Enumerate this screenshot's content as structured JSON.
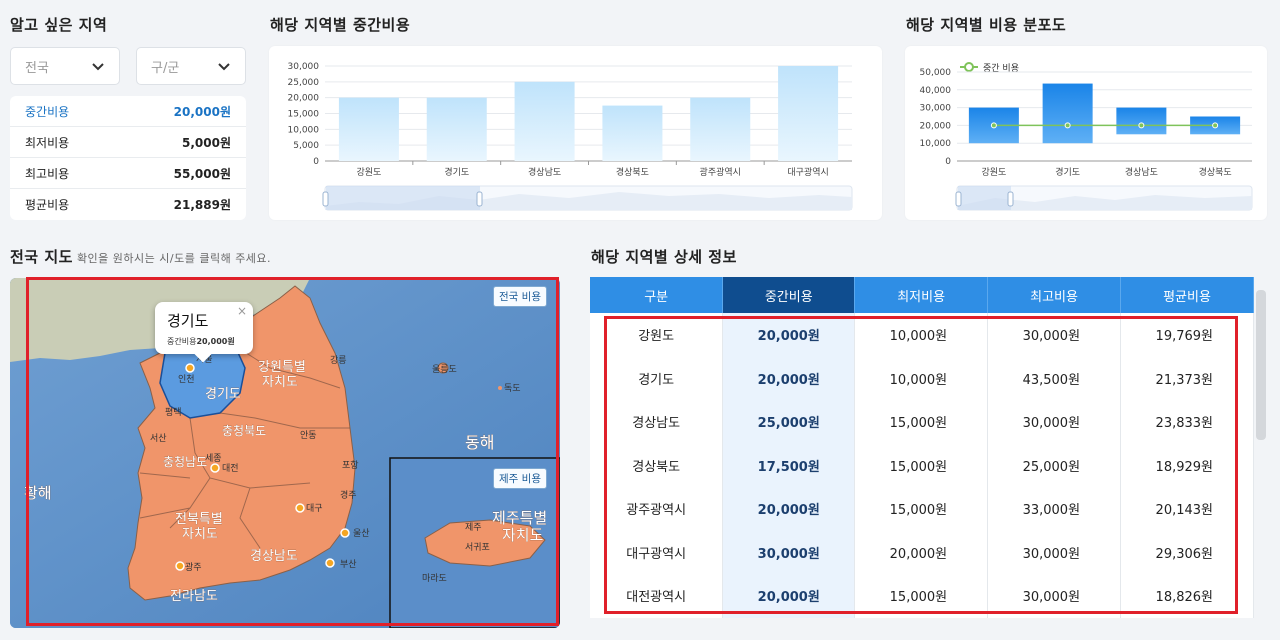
{
  "filters": {
    "title": "알고 싶은 지역",
    "region_select": "전국",
    "district_select": "구/군"
  },
  "stats": [
    {
      "label": "중간비용",
      "value": "20,000원",
      "active": true
    },
    {
      "label": "최저비용",
      "value": "5,000원"
    },
    {
      "label": "최고비용",
      "value": "55,000원"
    },
    {
      "label": "평균비용",
      "value": "21,889원"
    }
  ],
  "median_chart": {
    "title": "해당 지역별 중간비용",
    "chart_data": {
      "type": "bar",
      "categories": [
        "강원도",
        "경기도",
        "경상남도",
        "경상북도",
        "광주광역시",
        "대구광역시"
      ],
      "values": [
        20000,
        20000,
        25000,
        17500,
        20000,
        30000
      ],
      "yticks": [
        "30,000",
        "25,000",
        "20,000",
        "15,000",
        "10,000",
        "5,000",
        "0"
      ],
      "ylim": [
        0,
        30000
      ]
    }
  },
  "dist_chart": {
    "title": "해당 지역별 비용 분포도",
    "legend": "중간 비용",
    "chart_data": {
      "type": "bar",
      "categories": [
        "강원도",
        "경기도",
        "경상남도",
        "경상북도"
      ],
      "range_low": [
        10000,
        10000,
        15000,
        15000
      ],
      "range_high": [
        30000,
        43500,
        30000,
        25000
      ],
      "median": [
        20000,
        20000,
        20000,
        20000
      ],
      "yticks": [
        "50,000",
        "40,000",
        "30,000",
        "20,000",
        "10,000",
        "0"
      ],
      "ylim": [
        0,
        50000
      ]
    }
  },
  "map": {
    "title": "전국 지도",
    "hint": "확인을 원하시는 시/도를 클릭해 주세요.",
    "nationwide_btn": "전국 비용",
    "jeju_btn": "제주 비용",
    "popup_title": "경기도",
    "popup_label": "중간비용",
    "popup_value": "20,000원",
    "popup_close": "×",
    "labels": {
      "gangwon": "강원특별",
      "gangwon2": "자치도",
      "gyeonggi": "경기도",
      "seoul": "서울",
      "incheon": "인천",
      "chungbuk": "충청북도",
      "chungnam": "충청남도",
      "sejong": "세종",
      "daejeon": "대전",
      "jeonbuk": "전북특별",
      "jeonbuk2": "자치도",
      "jeonnam": "전라남도",
      "gwangju": "광주",
      "gyeongnam": "경상남도",
      "daegu": "대구",
      "ulsan": "울산",
      "busan": "부산",
      "ulleungdo": "울릉도",
      "dokdo": "독도",
      "east_sea": "동해",
      "yellow_sea": "황해",
      "jeju_title": "제주특별",
      "jeju_title2": "자치도",
      "jeju_city": "제주",
      "seogwipo": "서귀포",
      "marado": "마라도",
      "pyeongtaek": "평택",
      "seosan": "서산",
      "gangneung": "강릉",
      "andong": "안동",
      "pohang": "포항",
      "gyeongju": "경주"
    }
  },
  "detail": {
    "title": "해당 지역별 상세 정보",
    "columns": [
      "구분",
      "중간비용",
      "최저비용",
      "최고비용",
      "평균비용"
    ],
    "rows": [
      [
        "강원도",
        "20,000원",
        "10,000원",
        "30,000원",
        "19,769원"
      ],
      [
        "경기도",
        "20,000원",
        "10,000원",
        "43,500원",
        "21,373원"
      ],
      [
        "경상남도",
        "25,000원",
        "15,000원",
        "30,000원",
        "23,833원"
      ],
      [
        "경상북도",
        "17,500원",
        "15,000원",
        "25,000원",
        "18,929원"
      ],
      [
        "광주광역시",
        "20,000원",
        "15,000원",
        "33,000원",
        "20,143원"
      ],
      [
        "대구광역시",
        "30,000원",
        "20,000원",
        "30,000원",
        "29,306원"
      ],
      [
        "대전광역시",
        "20,000원",
        "15,000원",
        "30,000원",
        "18,826원"
      ]
    ]
  },
  "colors": {
    "accent": "#2f8ee5",
    "accent_dark": "#0f4d8f",
    "map_region": "#f0956a",
    "map_selected": "#5b9be0",
    "highlight_box": "#e0202a"
  }
}
